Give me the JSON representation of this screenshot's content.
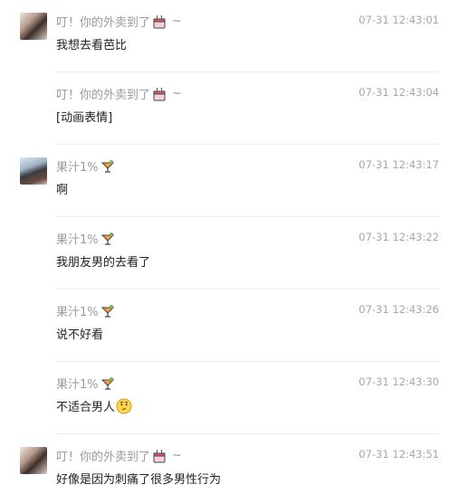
{
  "messages": [
    {
      "sender": "叮！你的外卖到了",
      "sender_emoji": "takeout-box",
      "sender_suffix": "~",
      "time": "07-31 12:43:01",
      "text": "我想去看芭比",
      "show_avatar": true,
      "avatar_style": "a"
    },
    {
      "sender": "叮！你的外卖到了",
      "sender_emoji": "takeout-box",
      "sender_suffix": "~",
      "time": "07-31 12:43:04",
      "text": "[动画表情]",
      "show_avatar": false
    },
    {
      "sender": "果汁1%",
      "sender_emoji": "tropical-drink",
      "sender_suffix": "",
      "time": "07-31 12:43:17",
      "text": "啊",
      "show_avatar": true,
      "avatar_style": "b"
    },
    {
      "sender": "果汁1%",
      "sender_emoji": "tropical-drink",
      "sender_suffix": "",
      "time": "07-31 12:43:22",
      "text": "我朋友男的去看了",
      "show_avatar": false
    },
    {
      "sender": "果汁1%",
      "sender_emoji": "tropical-drink",
      "sender_suffix": "",
      "time": "07-31 12:43:26",
      "text": "说不好看",
      "show_avatar": false
    },
    {
      "sender": "果汁1%",
      "sender_emoji": "tropical-drink",
      "sender_suffix": "",
      "time": "07-31 12:43:30",
      "text": "不适合男人",
      "text_emoji": "thinking-face",
      "show_avatar": false
    },
    {
      "sender": "叮！你的外卖到了",
      "sender_emoji": "takeout-box",
      "sender_suffix": "~",
      "time": "07-31 12:43:51",
      "text": "好像是因为刺痛了很多男性行为",
      "show_avatar": true,
      "avatar_style": "a"
    }
  ]
}
